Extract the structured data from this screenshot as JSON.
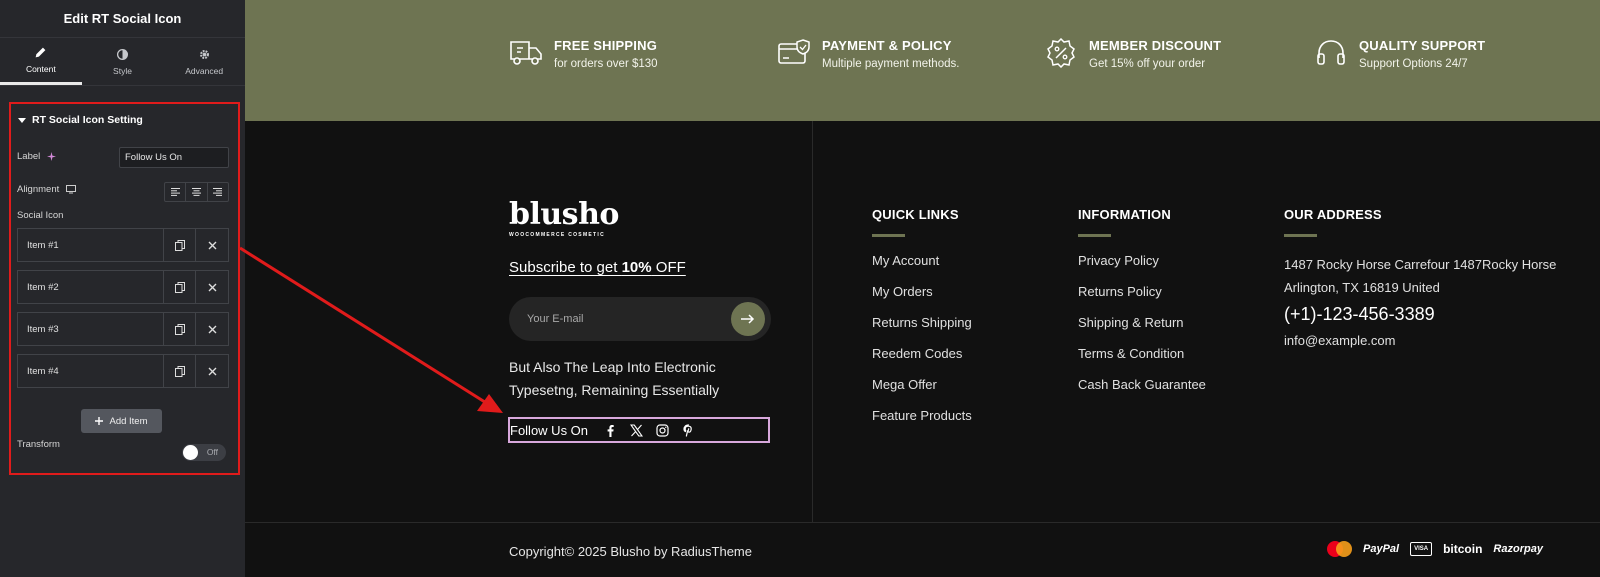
{
  "editor": {
    "title": "Edit RT Social Icon",
    "tabs": [
      {
        "label": "Content",
        "icon": "pencil-icon"
      },
      {
        "label": "Style",
        "icon": "half-circle-icon"
      },
      {
        "label": "Advanced",
        "icon": "gear-icon"
      }
    ],
    "section_title": "RT Social Icon Setting",
    "label_field": {
      "label": "Label",
      "value": "Follow Us On"
    },
    "alignment_label": "Alignment",
    "social_icon_label": "Social Icon",
    "items": [
      "Item #1",
      "Item #2",
      "Item #3",
      "Item #4"
    ],
    "add_item_label": "Add Item",
    "transform_label": "Transform",
    "transform_toggle": "Off"
  },
  "banner": {
    "features": [
      {
        "title": "FREE SHIPPING",
        "subtitle": "for orders over $130",
        "icon": "truck-icon"
      },
      {
        "title": "PAYMENT & POLICY",
        "subtitle": "Multiple payment methods.",
        "icon": "card-shield-icon"
      },
      {
        "title": "MEMBER DISCOUNT",
        "subtitle": "Get 15% off your order",
        "icon": "percent-badge-icon"
      },
      {
        "title": "QUALITY SUPPORT",
        "subtitle": "Support Options 24/7",
        "icon": "headphones-icon"
      }
    ]
  },
  "footer": {
    "logo_word": "blusho",
    "logo_tag": "WOOCOMMERCE COSMETIC",
    "subscribe": {
      "pre": "Subscribe to get ",
      "bold": "10%",
      "post": " OFF"
    },
    "email_placeholder": "Your E-mail",
    "about": "But Also The Leap Into Electronic Typesetng, Remaining Essentially",
    "follow_label": "Follow Us On",
    "social_icons": [
      "facebook-icon",
      "x-icon",
      "instagram-icon",
      "pinterest-icon"
    ],
    "quick_links": {
      "heading": "QUICK LINKS",
      "links": [
        "My Account",
        "My Orders",
        "Returns Shipping",
        "Reedem Codes",
        "Mega Offer",
        "Feature Products"
      ]
    },
    "information": {
      "heading": "INFORMATION",
      "links": [
        "Privacy Policy",
        "Returns Policy",
        "Shipping & Return",
        "Terms & Condition",
        "Cash Back Guarantee"
      ]
    },
    "address": {
      "heading": "OUR ADDRESS",
      "text": "1487 Rocky Horse Carrefour 1487Rocky Horse Arlington, TX 16819 United",
      "phone": "(+1)-123-456-3389",
      "email": "info@example.com"
    },
    "copyright": "Copyright© 2025 Blusho by RadiusTheme",
    "payment": {
      "paypal": "PayPal",
      "visa": "VISA",
      "bitcoin": "bitcoin",
      "razorpay": "Razorpay",
      "mastercard": "MasterCard"
    }
  },
  "colors": {
    "accent": "#6e7452",
    "panel": "#26272b",
    "annotation": "#e01b1b",
    "highlight": "#d8a8dc"
  }
}
